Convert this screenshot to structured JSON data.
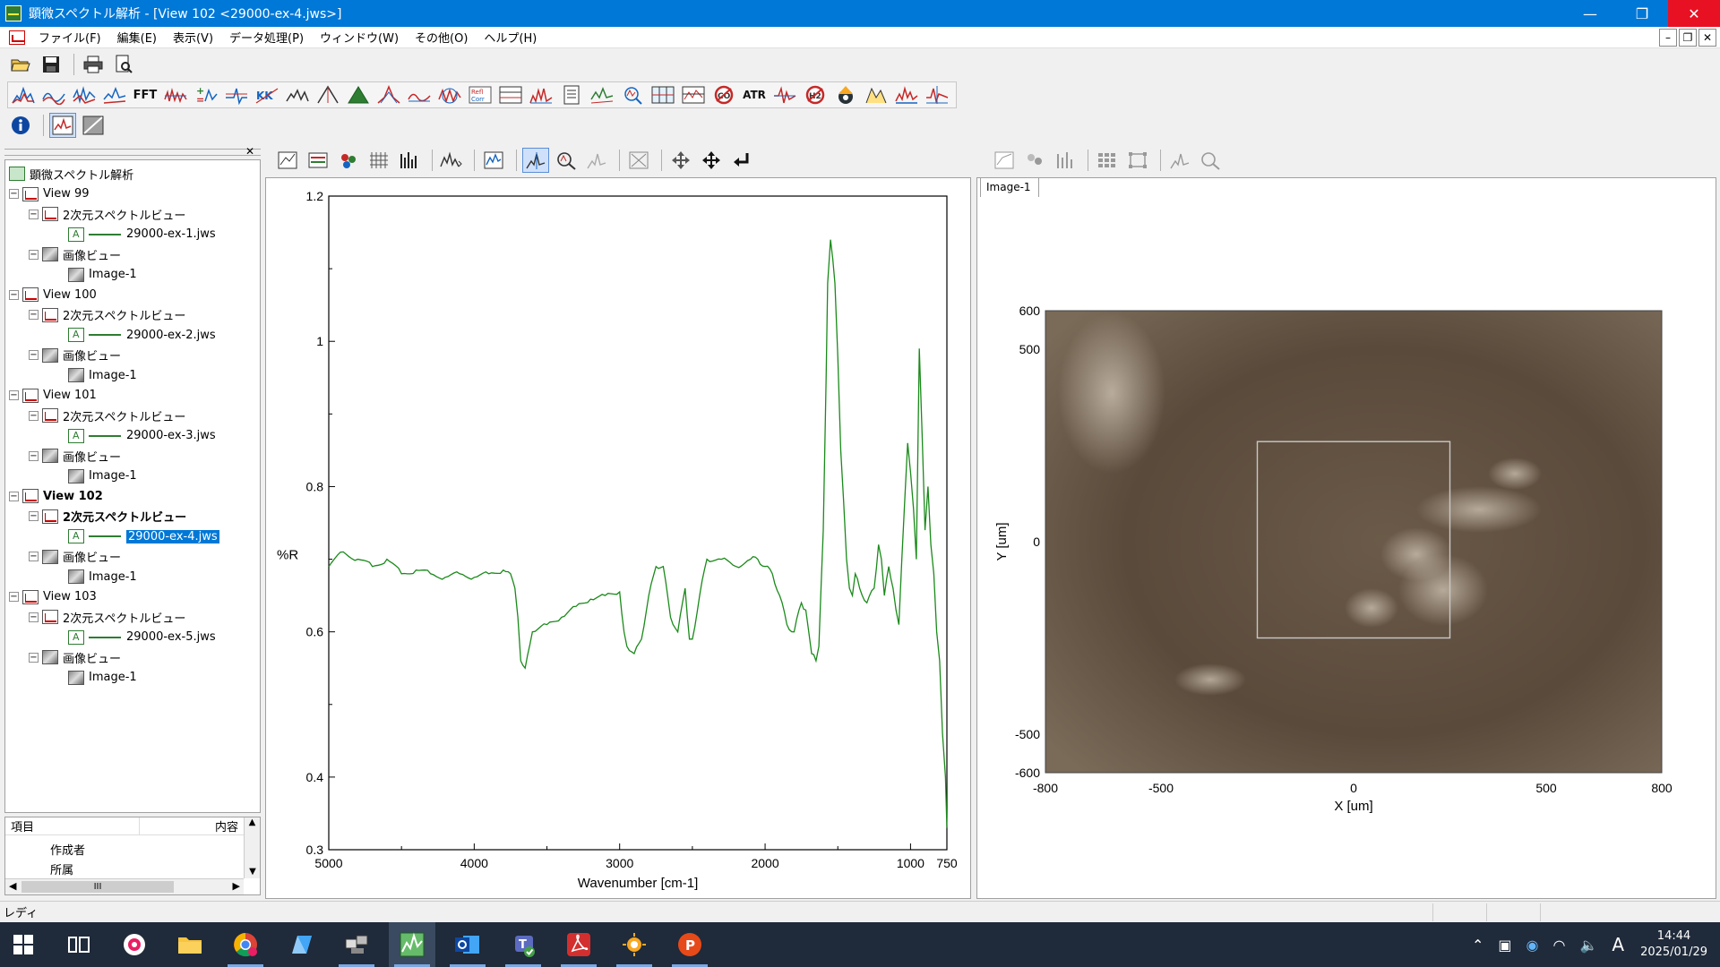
{
  "window": {
    "title": "顕微スペクトル解析 - [View 102 <29000-ex-4.jws>]",
    "minimize": "—",
    "restore": "❐",
    "close": "✕"
  },
  "menu": [
    "ファイル(F)",
    "編集(E)",
    "表示(V)",
    "データ処理(P)",
    "ウィンドウ(W)",
    "その他(O)",
    "ヘルプ(H)"
  ],
  "toolbar": {
    "fft_label": "FFT",
    "atr_label": "ATR"
  },
  "tree": {
    "root": "顕微スペクトル解析",
    "views": [
      {
        "name": "View 99",
        "spectrum_view": "2次元スペクトルビュー",
        "file": "29000-ex-1.jws",
        "image_view": "画像ビュー",
        "image": "Image-1"
      },
      {
        "name": "View 100",
        "spectrum_view": "2次元スペクトルビュー",
        "file": "29000-ex-2.jws",
        "image_view": "画像ビュー",
        "image": "Image-1"
      },
      {
        "name": "View 101",
        "spectrum_view": "2次元スペクトルビュー",
        "file": "29000-ex-3.jws",
        "image_view": "画像ビュー",
        "image": "Image-1"
      },
      {
        "name": "View 102",
        "spectrum_view": "2次元スペクトルビュー",
        "file": "29000-ex-4.jws",
        "image_view": "画像ビュー",
        "image": "Image-1"
      },
      {
        "name": "View 103",
        "spectrum_view": "2次元スペクトルビュー",
        "file": "29000-ex-5.jws",
        "image_view": "画像ビュー",
        "image": "Image-1"
      }
    ]
  },
  "props": {
    "col_item": "項目",
    "col_content": "内容",
    "rows": [
      "作成者",
      "所属"
    ],
    "scroll_mark": "III"
  },
  "image_tab": "Image-1",
  "status": "レディ",
  "clock": {
    "time": "14:44",
    "date": "2025/01/29"
  },
  "chart_data": [
    {
      "type": "line",
      "xlabel": "Wavenumber [cm-1]",
      "ylabel": "%R",
      "xlim": [
        5000,
        750
      ],
      "ylim": [
        0.3,
        1.2
      ],
      "x_ticks": [
        "5000",
        "4000",
        "3000",
        "2000",
        "1000",
        "750"
      ],
      "y_ticks": [
        "1.2",
        "1",
        "0.8",
        "0.6",
        "0.4",
        "0.3"
      ],
      "series": [
        {
          "color": "#1a8a1a",
          "x": [
            5000,
            4900,
            4800,
            4700,
            4600,
            4500,
            4400,
            4300,
            4200,
            4100,
            4000,
            3900,
            3800,
            3750,
            3720,
            3700,
            3680,
            3650,
            3600,
            3500,
            3400,
            3300,
            3200,
            3100,
            3000,
            2970,
            2950,
            2900,
            2850,
            2800,
            2750,
            2700,
            2650,
            2600,
            2550,
            2520,
            2500,
            2450,
            2400,
            2300,
            2200,
            2100,
            2050,
            2000,
            1950,
            1900,
            1850,
            1800,
            1750,
            1720,
            1700,
            1680,
            1650,
            1630,
            1600,
            1580,
            1570,
            1550,
            1520,
            1500,
            1480,
            1460,
            1440,
            1420,
            1400,
            1380,
            1350,
            1300,
            1250,
            1220,
            1200,
            1180,
            1150,
            1120,
            1100,
            1080,
            1060,
            1040,
            1020,
            1000,
            980,
            960,
            950,
            940,
            920,
            900,
            880,
            860,
            840,
            820,
            800,
            780,
            760,
            750
          ],
          "y": [
            0.69,
            0.71,
            0.7,
            0.69,
            0.7,
            0.68,
            0.685,
            0.68,
            0.675,
            0.68,
            0.675,
            0.68,
            0.685,
            0.68,
            0.66,
            0.62,
            0.56,
            0.55,
            0.6,
            0.61,
            0.62,
            0.635,
            0.645,
            0.65,
            0.655,
            0.6,
            0.58,
            0.57,
            0.59,
            0.65,
            0.69,
            0.69,
            0.62,
            0.6,
            0.66,
            0.59,
            0.59,
            0.65,
            0.7,
            0.7,
            0.69,
            0.7,
            0.7,
            0.69,
            0.68,
            0.65,
            0.61,
            0.6,
            0.64,
            0.63,
            0.6,
            0.57,
            0.56,
            0.58,
            0.74,
            0.95,
            1.08,
            1.14,
            1.08,
            0.98,
            0.85,
            0.78,
            0.7,
            0.66,
            0.65,
            0.68,
            0.66,
            0.64,
            0.66,
            0.72,
            0.7,
            0.65,
            0.69,
            0.66,
            0.63,
            0.61,
            0.7,
            0.78,
            0.86,
            0.82,
            0.77,
            0.7,
            0.84,
            0.99,
            0.87,
            0.74,
            0.8,
            0.72,
            0.68,
            0.6,
            0.56,
            0.46,
            0.4,
            0.33
          ]
        }
      ]
    },
    {
      "type": "image",
      "xlabel": "X [um]",
      "ylabel": "Y [um]",
      "xlim": [
        -800,
        800
      ],
      "ylim": [
        -600,
        600
      ],
      "x_ticks": [
        "-800",
        "-500",
        "0",
        "500",
        "800"
      ],
      "y_ticks": [
        "600",
        "500",
        "0",
        "-500",
        "-600"
      ],
      "roi": {
        "x": [
          -250,
          250
        ],
        "y": [
          -250,
          260
        ]
      }
    }
  ]
}
